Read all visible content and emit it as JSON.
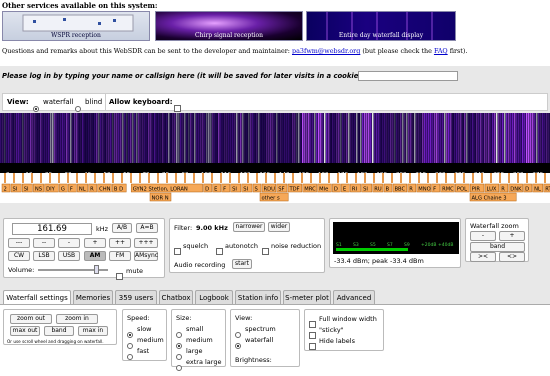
{
  "top": {
    "title": "Other services available on this system:",
    "thumbs": [
      {
        "label": "WSPR reception"
      },
      {
        "label": "Chirp signal reception"
      },
      {
        "label": "Entire day waterfall display"
      }
    ],
    "questions_pre": "Questions and remarks about this WebSDR can be sent to the developer and maintainer: ",
    "email": "pa3fwm@websdr.org",
    "questions_mid": " (but please check the ",
    "faq": "FAQ",
    "questions_post": " first)."
  },
  "login": {
    "prompt": "Please log in by typing your name or callsign here (it will be saved for later visits in a cookie):",
    "value": ""
  },
  "view": {
    "label": "View:",
    "waterfall": "waterfall",
    "blind": "blind",
    "allow_keyboard": "Allow keyboard:"
  },
  "scale_ticks": [
    "0",
    "10",
    "20",
    "30",
    "40",
    "50",
    "60",
    "70",
    "80",
    "90",
    "100",
    "110",
    "120",
    "130",
    "140",
    "150",
    "160",
    "170",
    "180",
    "190",
    "200",
    "210",
    "220",
    "230",
    "240",
    "250",
    "260",
    "270",
    "280"
  ],
  "scale_mid": [
    "152",
    "162",
    "175",
    "198",
    "216",
    "225",
    "234",
    "243"
  ],
  "bands": {
    "row1": [
      "2",
      "SI",
      "SI",
      "NS",
      "DIY",
      "G",
      "F",
      "NL",
      "R",
      "CHN",
      "B D",
      "GYN2 Stetlon, LORAN",
      "D",
      "E",
      "F",
      "SI",
      "SI",
      "S",
      "RDU",
      "SF",
      "TDF",
      "MRC",
      "MIe",
      "D",
      "E",
      "RI",
      "SI",
      "RU",
      "B",
      "BBC",
      "R",
      "MNO",
      "F",
      "RMC",
      "POL",
      "PIR",
      "LUX",
      "R",
      "DNK",
      "D",
      "NL",
      "RTE Radio 1"
    ],
    "row2": [
      "NOR N",
      "other s",
      "ALG Chaine 3"
    ]
  },
  "freq": {
    "value": "161.69",
    "unit": "kHz",
    "ab": "A/B",
    "aeqb": "A=B",
    "steps": [
      "---",
      "--",
      "-",
      "+",
      "++",
      "+++"
    ],
    "modes": [
      "CW",
      "LSB",
      "USB",
      "AM",
      "FM",
      "AMsync"
    ],
    "selected_mode": "AM",
    "volume": "Volume:",
    "mute": "mute"
  },
  "filter": {
    "label": "Filter:",
    "value": "9.00 kHz",
    "narrower": "narrower",
    "wider": "wider",
    "squelch": "squelch",
    "autonotch": "autonotch",
    "noise_reduction": "noise reduction",
    "audio_recording": "Audio recording",
    "start": "start"
  },
  "smeter": {
    "scale": [
      "S1",
      "S3",
      "S5",
      "S7",
      "S9",
      "+20dB",
      "+40dB"
    ],
    "reading": "-33.4 dBm; peak  -33.4 dBm"
  },
  "zoom": {
    "title": "Waterfall zoom",
    "minus": "-",
    "plus": "+",
    "band": "band",
    "left": "><",
    "right": "<>"
  },
  "tabs": [
    "Waterfall settings",
    "Memories",
    "359 users",
    "Chatbox",
    "Logbook",
    "Station info",
    "S-meter plot",
    "Advanced"
  ],
  "wfsettings": {
    "zoom_out": "zoom out",
    "zoom_in": "zoom in",
    "max_out": "max out",
    "band": "band",
    "max_in": "max in",
    "hint": "Or use scroll wheel and dragging on waterfall.",
    "speed": "Speed:",
    "speeds": [
      "slow",
      "medium",
      "fast"
    ],
    "size": "Size:",
    "sizes": [
      "small",
      "medium",
      "large",
      "extra large"
    ],
    "view": "View:",
    "views": [
      "spectrum",
      "waterfall"
    ],
    "brightness": "Brightness:",
    "full_width": "Full window width",
    "sticky": "\"sticky\"",
    "hide_labels": "Hide labels"
  }
}
